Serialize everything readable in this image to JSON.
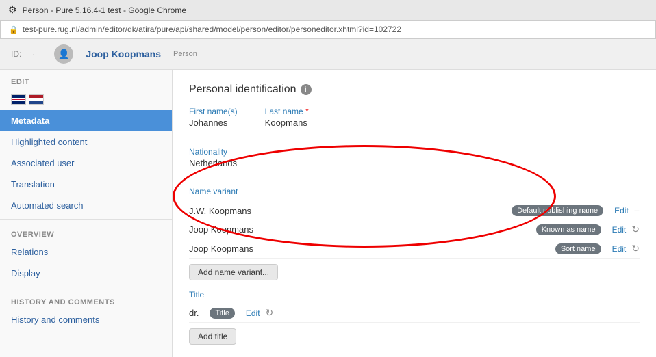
{
  "browser": {
    "title": "Person - Pure 5.16.4-1 test - Google Chrome",
    "url": "test-pure.rug.nl/admin/editor/dk/atira/pure/api/shared/model/person/editor/personeditor.xhtml?id=102722"
  },
  "header": {
    "id_label": "ID:",
    "id_value": "·",
    "person_name": "Joop Koopmans",
    "person_type": "Person"
  },
  "sidebar": {
    "edit_label": "EDIT",
    "items": [
      {
        "label": "Metadata",
        "active": true
      },
      {
        "label": "Highlighted content",
        "active": false
      },
      {
        "label": "Associated user",
        "active": false
      },
      {
        "label": "Translation",
        "active": false
      },
      {
        "label": "Automated search",
        "active": false
      }
    ],
    "overview_label": "OVERVIEW",
    "overview_items": [
      {
        "label": "Relations"
      },
      {
        "label": "Display"
      }
    ],
    "history_label": "HISTORY AND COMMENTS",
    "history_items": [
      {
        "label": "History and comments"
      }
    ]
  },
  "main": {
    "section_title": "Personal identification",
    "first_name_label": "First name(s)",
    "first_name_value": "Johannes",
    "last_name_label": "Last name",
    "last_name_required": "*",
    "last_name_value": "Koopmans",
    "nationality_label": "Nationality",
    "nationality_value": "Netherlands",
    "name_variant_label": "Name variant",
    "name_variants": [
      {
        "name": "J.W. Koopmans",
        "badge": "Default publishing name",
        "badge_class": "badge-default"
      },
      {
        "name": "Joop Koopmans",
        "badge": "Known as name",
        "badge_class": "badge-known"
      },
      {
        "name": "Joop Koopmans",
        "badge": "Sort name",
        "badge_class": "badge-sort"
      }
    ],
    "add_name_variant_btn": "Add name variant...",
    "title_label": "Title",
    "title_value": "dr.",
    "title_badge": "Title",
    "add_title_btn": "Add title"
  },
  "icons": {
    "edit_text": "Edit",
    "refresh": "↻",
    "minus": "−",
    "info": "i",
    "person": "👤",
    "lock": "🔒"
  }
}
